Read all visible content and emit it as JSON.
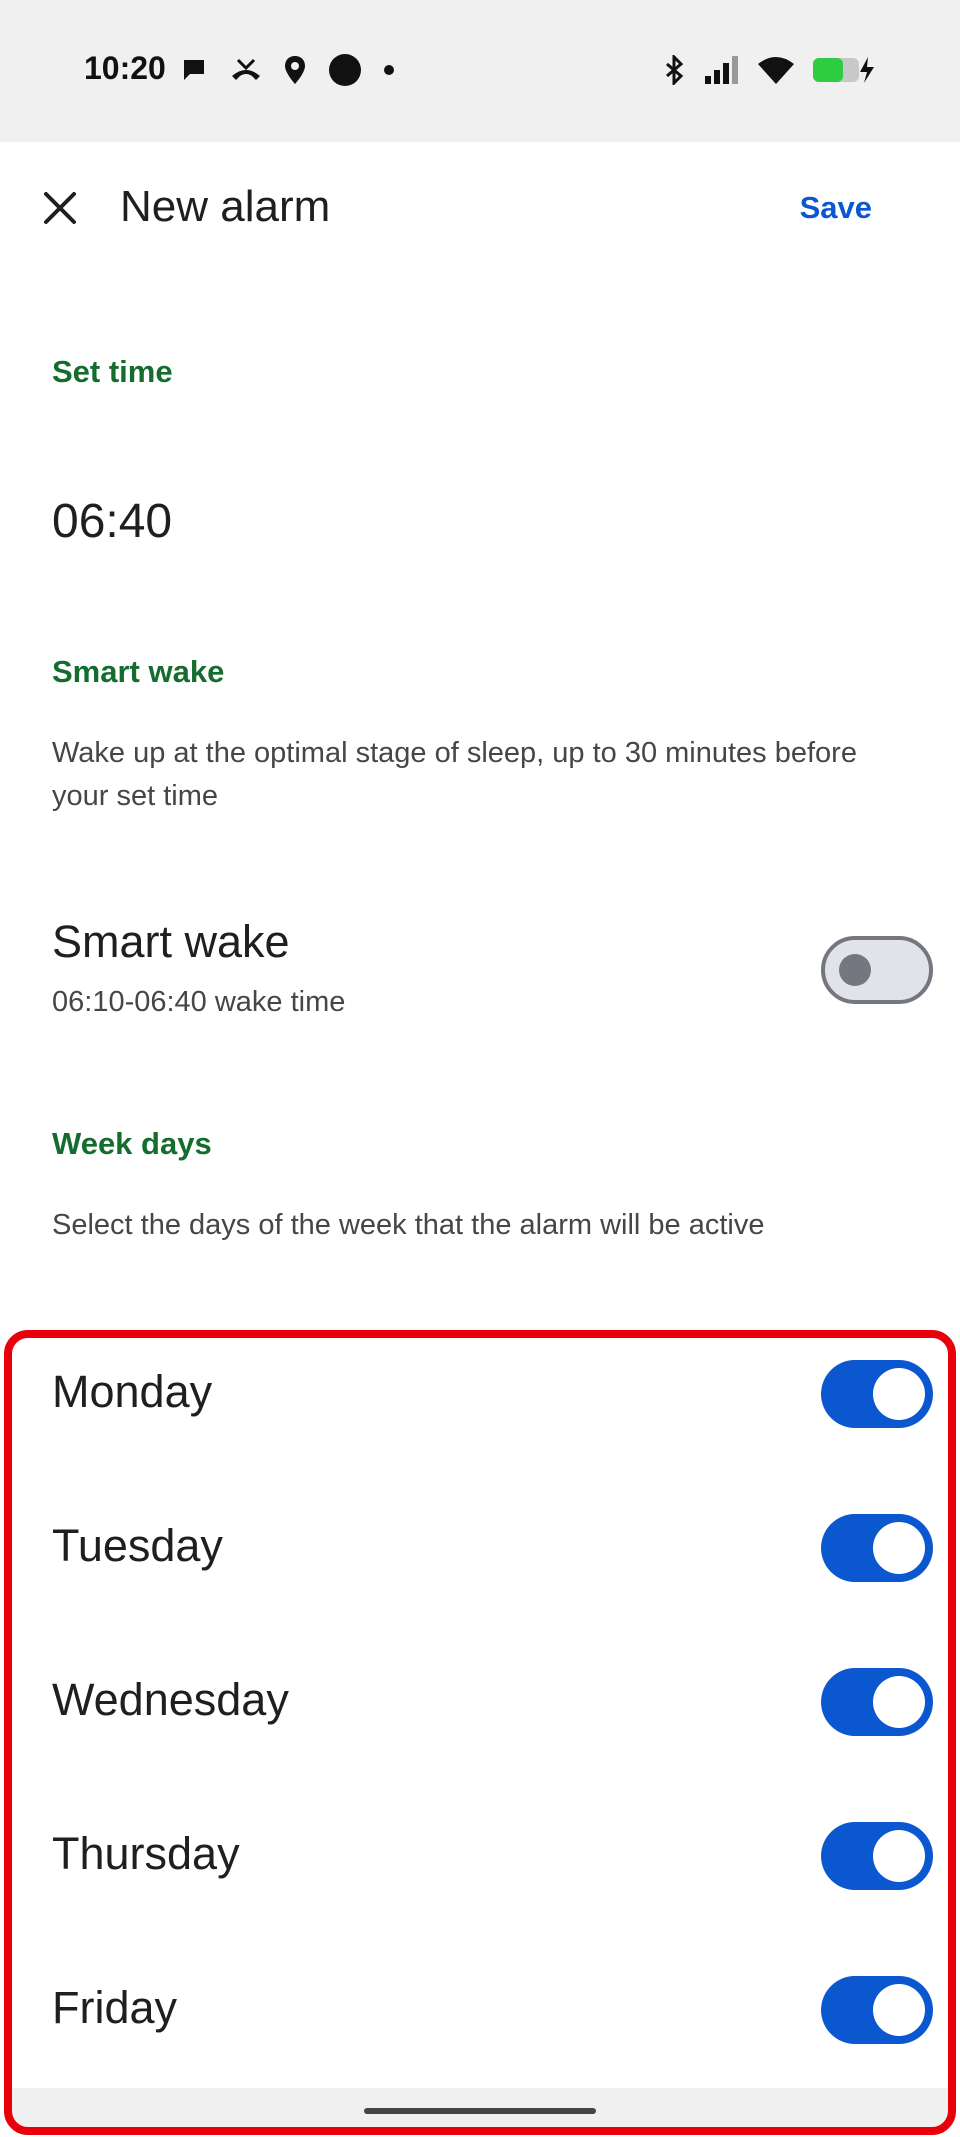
{
  "status_bar": {
    "time": "10:20",
    "left_icons": [
      "message-icon",
      "missed-call-icon",
      "location-icon",
      "circle-icon",
      "dot-icon"
    ],
    "right_icons": [
      "bluetooth-icon",
      "signal-icon",
      "wifi-icon",
      "battery-charging-icon"
    ],
    "battery_color": "#2ecc40"
  },
  "app_bar": {
    "title": "New alarm",
    "save_label": "Save",
    "close_icon": "close-icon"
  },
  "set_time": {
    "label": "Set time",
    "value": "06:40"
  },
  "smart_wake": {
    "label": "Smart wake",
    "description": "Wake up at the optimal stage of sleep, up to 30 minutes before your set time",
    "row_title": "Smart wake",
    "row_subtitle": "06:10-06:40 wake time",
    "enabled": false
  },
  "week_days": {
    "label": "Week days",
    "description": "Select the days of the week that the alarm will be active",
    "days": [
      {
        "name": "Monday",
        "enabled": true
      },
      {
        "name": "Tuesday",
        "enabled": true
      },
      {
        "name": "Wednesday",
        "enabled": true
      },
      {
        "name": "Thursday",
        "enabled": true
      },
      {
        "name": "Friday",
        "enabled": true
      }
    ]
  },
  "colors": {
    "accent": "#0b57d0",
    "section_label": "#146c2e",
    "highlight": "#e8000b"
  }
}
